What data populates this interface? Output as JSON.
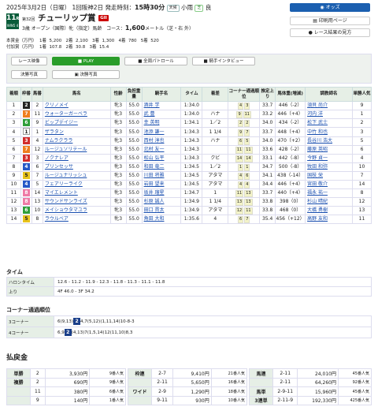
{
  "header": {
    "date_line": "2025年3月2日（日曜） 1回阪神2日",
    "start_label": "発走時刻：",
    "start_time": "15時30分",
    "weather_label": "天候",
    "weather": "小雨",
    "track_label": "芝",
    "track_state": "良"
  },
  "race": {
    "number": "11",
    "number_suffix": "R",
    "badge": "WIN5 4",
    "edition": "第32回",
    "name": "チューリップ賞",
    "grade": "GII",
    "subline": "3歳 オープン（国際）牝（指定）馬齢",
    "course_label": "コース：",
    "distance": "1,600",
    "distance_unit": "メートル（芝・右 外）"
  },
  "prize": {
    "line1": "本賞金（万円）  1着  5,200   2着  2,100   3着  1,300   4着  780   5着  520",
    "line2": "付加賞（万円）  1着  107.8   2着  30.8   3着  15.4"
  },
  "right_buttons": {
    "odds": "オッズ",
    "print": "印刷用ページ",
    "nav": "レース結果の見方"
  },
  "panel": {
    "movie_label": "レース映像",
    "play": "PLAY",
    "patrol": "全周パトロール",
    "interview": "騎手インタビュー",
    "photo_label": "決勝写真",
    "photo_btn": "決勝写真"
  },
  "columns": [
    "着順",
    "枠番",
    "馬番",
    "馬名",
    "性齢",
    "負担重量",
    "騎手名",
    "タイム",
    "着差",
    "コーナー通過順位",
    "推定上り",
    "馬体重(増減)",
    "調教師名",
    "単勝人気"
  ],
  "colors": {
    "waku": [
      "#ffffff",
      "#222222",
      "#d22b2b",
      "#2557c7",
      "#e8c31c",
      "#2e9e3a",
      "#ef7d1e",
      "#ee7aa6"
    ]
  },
  "rows": [
    {
      "pos": "1",
      "w": "2",
      "n": "2",
      "horse": "クリノメイ",
      "sa": "牝3",
      "wt": "55.0",
      "jk": "酒井 学",
      "tm": "1:34.0",
      "mg": "",
      "cn": [
        "4",
        "3"
      ],
      "ag": "33.7",
      "bw": "446（-2）",
      "tr": "須貝 尚介",
      "pop": "9"
    },
    {
      "pos": "2",
      "w": "7",
      "n": "11",
      "horse": "ウォーターガーベラ",
      "sa": "牝3",
      "wt": "55.0",
      "jk": "武 豊",
      "tm": "1:34.0",
      "mg": "ハナ",
      "cn": [
        "9",
        "11"
      ],
      "ag": "33.2",
      "bw": "446（+4）",
      "tr": "河内 洋",
      "pop": "1"
    },
    {
      "pos": "3",
      "w": "6",
      "n": "9",
      "horse": "ビップデイジー",
      "sa": "牝3",
      "wt": "55.0",
      "jk": "幸 英明",
      "tm": "1:34.1",
      "mg": "1／2",
      "cn": [
        "2",
        "2"
      ],
      "ag": "34.0",
      "bw": "434（-2）",
      "tr": "松下 武士",
      "pop": "2"
    },
    {
      "pos": "4",
      "w": "1",
      "n": "1",
      "horse": "ザラタン",
      "sa": "牝3",
      "wt": "55.0",
      "jk": "池添 謙一",
      "tm": "1:34.3",
      "mg": "1 1/4",
      "cn": [
        "9",
        "7"
      ],
      "ag": "33.7",
      "bw": "448（+4）",
      "tr": "中竹 和也",
      "pop": "3"
    },
    {
      "pos": "5",
      "w": "3",
      "n": "4",
      "horse": "ナムラクララ",
      "sa": "牝3",
      "wt": "55.0",
      "jk": "西村 淳也",
      "tm": "1:34.3",
      "mg": "ハナ",
      "cn": [
        "6",
        "5"
      ],
      "ag": "34.0",
      "bw": "470（+2）",
      "tr": "長谷川 浩大",
      "pop": "5"
    },
    {
      "pos": "6",
      "w": "7",
      "n": "12",
      "horse": "ルージュソリテール",
      "sa": "牝3",
      "wt": "55.0",
      "jk": "北村 友一",
      "tm": "1:34.3",
      "mg": "",
      "cn": [
        "11",
        "11"
      ],
      "ag": "33.6",
      "bw": "428（-2）",
      "tr": "藤原 英昭",
      "pop": "6"
    },
    {
      "pos": "7",
      "w": "3",
      "n": "3",
      "horse": "ノクナレア",
      "sa": "牝3",
      "wt": "55.0",
      "jk": "松山 弘平",
      "tm": "1:34.3",
      "mg": "クビ",
      "cn": [
        "14",
        "14"
      ],
      "ag": "33.1",
      "bw": "442（-8）",
      "tr": "今野 貞一",
      "pop": "4"
    },
    {
      "pos": "8",
      "w": "4",
      "n": "6",
      "horse": "プリンセッサ",
      "sa": "牝3",
      "wt": "55.0",
      "jk": "和田 竜二",
      "tm": "1:34.5",
      "mg": "1／2",
      "cn": [
        "1",
        "1"
      ],
      "ag": "34.7",
      "bw": "500（-8）",
      "tr": "牧田 和弥",
      "pop": "10"
    },
    {
      "pos": "9",
      "w": "5",
      "n": "7",
      "horse": "ルージュナリッシュ",
      "sa": "牝3",
      "wt": "55.0",
      "jk": "川田 将雅",
      "tm": "1:34.5",
      "mg": "アタマ",
      "cn": [
        "4",
        "6"
      ],
      "ag": "34.1",
      "bw": "438（-14）",
      "tr": "国枝 栄",
      "pop": "7"
    },
    {
      "pos": "10",
      "w": "4",
      "n": "5",
      "horse": "フェアリーライク",
      "sa": "牝3",
      "wt": "55.0",
      "jk": "岩田 望来",
      "tm": "1:34.5",
      "mg": "アタマ",
      "cn": [
        "4",
        "4"
      ],
      "ag": "34.4",
      "bw": "446（+4）",
      "tr": "宮田 敬介",
      "pop": "14"
    },
    {
      "pos": "11",
      "w": "8",
      "n": "14",
      "horse": "マイエレメント",
      "sa": "牝3",
      "wt": "55.0",
      "jk": "坂井 瑠星",
      "tm": "1:34.7",
      "mg": "1",
      "cn": [
        "11",
        "13"
      ],
      "ag": "33.7",
      "bw": "440（+4）",
      "tr": "福永 祐一",
      "pop": "8"
    },
    {
      "pos": "12",
      "w": "8",
      "n": "13",
      "horse": "サウンドサンライズ",
      "sa": "牝3",
      "wt": "55.0",
      "jk": "杉原 誠人",
      "tm": "1:34.9",
      "mg": "1 1/4",
      "cn": [
        "13",
        "13"
      ],
      "ag": "33.8",
      "bw": "398（0）",
      "tr": "杉山 晴紀",
      "pop": "12"
    },
    {
      "pos": "13",
      "w": "6",
      "n": "10",
      "horse": "メイショウタマユラ",
      "sa": "牝3",
      "wt": "55.0",
      "jk": "田口 貫太",
      "tm": "1:34.9",
      "mg": "アタマ",
      "cn": [
        "12",
        "11"
      ],
      "ag": "33.8",
      "bw": "468（0）",
      "tr": "大橋 勇樹",
      "pop": "13"
    },
    {
      "pos": "14",
      "w": "5",
      "n": "8",
      "horse": "ラウルベア",
      "sa": "牝3",
      "wt": "55.0",
      "jk": "角田 大和",
      "tm": "1:35.6",
      "mg": "4",
      "cn": [
        "6",
        "7"
      ],
      "ag": "35.4",
      "bw": "456（+12）",
      "tr": "高野 友和",
      "pop": "11"
    }
  ],
  "time": {
    "heading": "タイム",
    "halon_label": "ハロンタイム",
    "halon": "12.6 - 11.2 - 11.9 - 12.3 - 11.8 - 11.3 - 11.1 - 11.8",
    "agari_label": "上り",
    "agari": "4F 46.0 - 3F 34.2"
  },
  "corner": {
    "heading": "コーナー通過順位",
    "c3_label": "3コーナー",
    "c3_pre": "6(9,13)",
    "c3_box": "2",
    "c3_post": "4,7(5,12)(1,11,14)10-8-3",
    "c4_label": "4コーナー",
    "c4_pre": "6,9",
    "c4_box": "2",
    "c4_post": "(4,13)7(1,5,14)12(11,10)8,3"
  },
  "payout": {
    "heading": "払戻金",
    "c1": [
      {
        "type": "単勝",
        "horse": "2",
        "yen": "3,930円",
        "pop": "9番人気"
      },
      {
        "type": "複勝",
        "horse": "2",
        "yen": "690円",
        "pop": "9番人気"
      },
      {
        "type": "",
        "horse": "11",
        "yen": "380円",
        "pop": "6番人気"
      },
      {
        "type": "",
        "horse": "9",
        "yen": "140円",
        "pop": "1番人気"
      }
    ],
    "c2": [
      {
        "type": "枠連",
        "horse": "2-7",
        "yen": "9,410円",
        "pop": "21番人気"
      },
      {
        "type": "",
        "horse": "2-11",
        "yen": "5,650円",
        "pop": "16番人気"
      },
      {
        "type": "ワイド",
        "horse": "2-9",
        "yen": "1,290円",
        "pop": "18番人気"
      },
      {
        "type": "",
        "horse": "9-11",
        "yen": "930円",
        "pop": "10番人気"
      }
    ],
    "c3": [
      {
        "type": "馬連",
        "horse": "2-11",
        "yen": "24,010円",
        "pop": "45番人気"
      },
      {
        "type": "",
        "horse": "2-11",
        "yen": "64,260円",
        "pop": "92番人気"
      },
      {
        "type": "馬単",
        "horse": "2-9-11",
        "yen": "15,960円",
        "pop": "45番人気"
      },
      {
        "type": "3連単",
        "horse": "2-11-9",
        "yen": "192,330円",
        "pop": "425番人気"
      }
    ]
  }
}
